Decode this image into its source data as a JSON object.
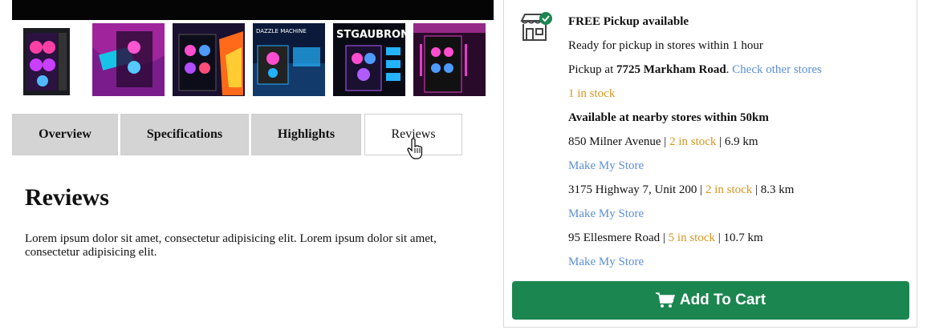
{
  "gallery": {
    "thumbnails": [
      {
        "name": "pc-case-thumb-1",
        "bg": "#f4f4f4",
        "accent": "#ff3fa6"
      },
      {
        "name": "pc-case-thumb-2",
        "bg": "#7b1c8c",
        "accent": "#17c4e8"
      },
      {
        "name": "pc-case-thumb-3",
        "bg": "#1a1030",
        "accent": "#ff6a1a"
      },
      {
        "name": "pc-case-thumb-4",
        "bg": "#0b1a3a",
        "accent": "#23b3ff"
      },
      {
        "name": "pc-case-thumb-5",
        "bg": "#0a0a14",
        "accent": "#b05cff"
      },
      {
        "name": "pc-case-thumb-6",
        "bg": "#2a0a2a",
        "accent": "#e040c8"
      }
    ],
    "thumbnail_texts": [
      "STGAUBRON",
      "DAZZLE MACHINE"
    ]
  },
  "tabs": [
    {
      "label": "Overview",
      "active": false
    },
    {
      "label": "Specifications",
      "active": false
    },
    {
      "label": "Highlights",
      "active": false
    },
    {
      "label": "Reviews",
      "active": true
    }
  ],
  "reviews": {
    "title": "Reviews",
    "body": "Lorem ipsum dolor sit amet, consectetur adipisicing elit. Lorem ipsum dolor sit amet, consectetur adipisicing elit."
  },
  "pickup": {
    "icon": "store-check-icon",
    "heading": "FREE Pickup available",
    "ready_text": "Ready for pickup in stores within 1 hour",
    "pickup_at_prefix": "Pickup at",
    "pickup_store": "7725 Markham Road",
    "pickup_period": ".",
    "check_other": "Check other stores",
    "stock": "1 in stock",
    "nearby_heading": "Available at nearby stores within 50km",
    "nearby": [
      {
        "address": "850 Milner Avenue",
        "stock": "2 in stock",
        "distance": "6.9 km",
        "action": "Make My Store"
      },
      {
        "address": "3175 Highway 7, Unit 200",
        "stock": "2 in stock",
        "distance": "8.3 km",
        "action": "Make My Store"
      },
      {
        "address": "95 Ellesmere Road",
        "stock": "5 in stock",
        "distance": "10.7 km",
        "action": "Make My Store"
      }
    ],
    "separator": "|"
  },
  "cart": {
    "label": "Add To Cart",
    "icon": "cart-icon",
    "color": "#1c8650"
  },
  "colors": {
    "link": "#5b8fd6",
    "stock": "#d4961f",
    "tab_bg": "#d4d4d4"
  }
}
